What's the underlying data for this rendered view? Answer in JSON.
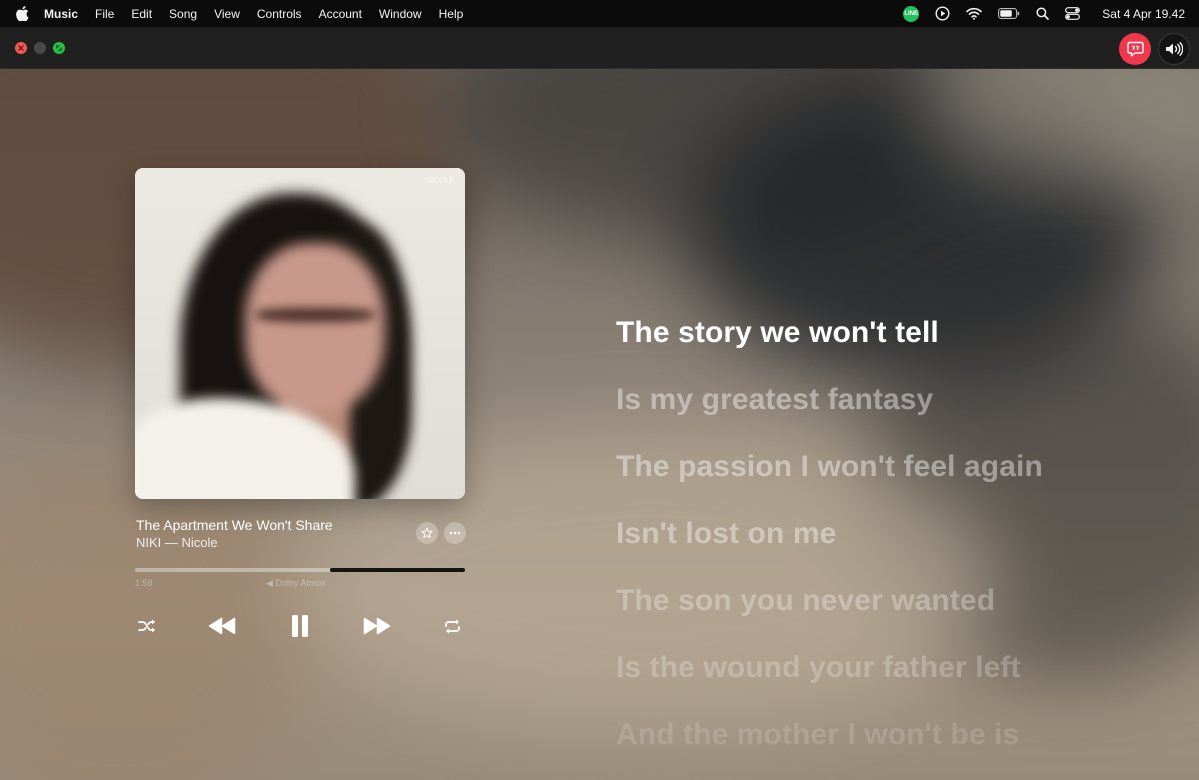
{
  "menubar": {
    "apple_icon": "apple-logo-icon",
    "app_name": "Music",
    "items": [
      "File",
      "Edit",
      "Song",
      "View",
      "Controls",
      "Account",
      "Window",
      "Help"
    ],
    "status_icons": [
      "line-app-icon",
      "play-circle-icon",
      "wifi-icon",
      "battery-icon",
      "spotlight-search-icon",
      "control-center-icon"
    ],
    "line_badge": "LINE",
    "clock": "Sat 4 Apr  19.42"
  },
  "titlebar": {
    "buttons": [
      "close",
      "minimize",
      "fullscreen"
    ],
    "lyrics_button_icon": "lyrics-quote-bubble-icon",
    "volume_button_icon": "speaker-volume-icon",
    "accent_color": "#f0384d"
  },
  "now_playing": {
    "title": "The Apartment We Won't Share",
    "artist_album": "NIKI — Nicole",
    "artwork_mark": "NICOLE",
    "progress_fraction": 0.59,
    "time_elapsed": "1:58",
    "quality_label": "◀ Dolby Atmos"
  },
  "controls": {
    "shuffle": "shuffle-icon",
    "previous": "rewind-icon",
    "pause": "pause-icon",
    "next": "fast-forward-icon",
    "repeat": "repeat-icon"
  },
  "lyrics": [
    "The story we won't tell",
    "Is my greatest fantasy",
    "The passion I won't feel again",
    "Isn't lost on me",
    "The son you never wanted",
    "Is the wound your father left",
    "And the mother I won't be is"
  ]
}
